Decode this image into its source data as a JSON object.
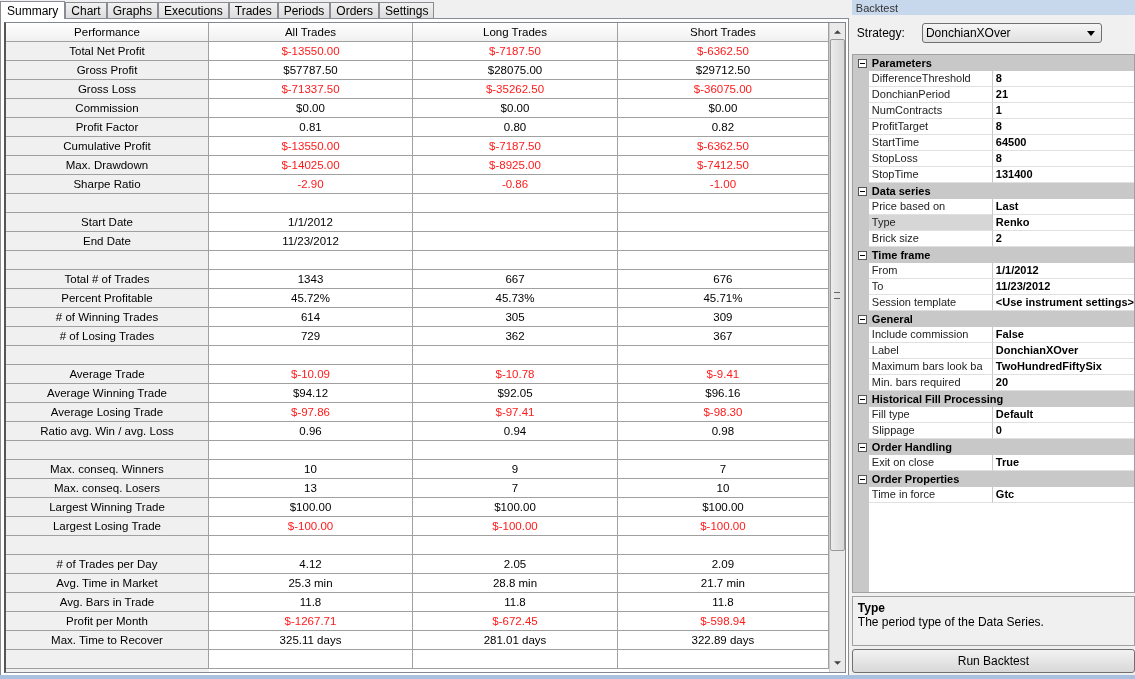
{
  "tabs": [
    {
      "label": "Summary",
      "selected": true
    },
    {
      "label": "Chart",
      "selected": false
    },
    {
      "label": "Graphs",
      "selected": false
    },
    {
      "label": "Executions",
      "selected": false
    },
    {
      "label": "Trades",
      "selected": false
    },
    {
      "label": "Periods",
      "selected": false
    },
    {
      "label": "Orders",
      "selected": false
    },
    {
      "label": "Settings",
      "selected": false
    }
  ],
  "table": {
    "columns": [
      "Performance",
      "All Trades",
      "Long Trades",
      "Short Trades"
    ],
    "rows": [
      {
        "kind": "stat",
        "label": "Total Net Profit",
        "values": [
          {
            "text": "$-13550.00",
            "negative": true
          },
          {
            "text": "$-7187.50",
            "negative": true
          },
          {
            "text": "$-6362.50",
            "negative": true
          }
        ]
      },
      {
        "kind": "stat",
        "label": "Gross Profit",
        "values": [
          {
            "text": "$57787.50",
            "negative": false
          },
          {
            "text": "$28075.00",
            "negative": false
          },
          {
            "text": "$29712.50",
            "negative": false
          }
        ]
      },
      {
        "kind": "stat",
        "label": "Gross Loss",
        "values": [
          {
            "text": "$-71337.50",
            "negative": true
          },
          {
            "text": "$-35262.50",
            "negative": true
          },
          {
            "text": "$-36075.00",
            "negative": true
          }
        ]
      },
      {
        "kind": "stat",
        "label": "Commission",
        "values": [
          {
            "text": "$0.00",
            "negative": false
          },
          {
            "text": "$0.00",
            "negative": false
          },
          {
            "text": "$0.00",
            "negative": false
          }
        ]
      },
      {
        "kind": "stat",
        "label": "Profit Factor",
        "values": [
          {
            "text": "0.81",
            "negative": false
          },
          {
            "text": "0.80",
            "negative": false
          },
          {
            "text": "0.82",
            "negative": false
          }
        ]
      },
      {
        "kind": "stat",
        "label": "Cumulative Profit",
        "values": [
          {
            "text": "$-13550.00",
            "negative": true
          },
          {
            "text": "$-7187.50",
            "negative": true
          },
          {
            "text": "$-6362.50",
            "negative": true
          }
        ]
      },
      {
        "kind": "stat",
        "label": "Max. Drawdown",
        "values": [
          {
            "text": "$-14025.00",
            "negative": true
          },
          {
            "text": "$-8925.00",
            "negative": true
          },
          {
            "text": "$-7412.50",
            "negative": true
          }
        ]
      },
      {
        "kind": "stat",
        "label": "Sharpe Ratio",
        "values": [
          {
            "text": "-2.90",
            "negative": true
          },
          {
            "text": "-0.86",
            "negative": true
          },
          {
            "text": "-1.00",
            "negative": true
          }
        ]
      },
      {
        "kind": "spacer"
      },
      {
        "kind": "stat",
        "label": "Start Date",
        "values": [
          {
            "text": "1/1/2012",
            "negative": false
          }
        ]
      },
      {
        "kind": "stat",
        "label": "End Date",
        "values": [
          {
            "text": "11/23/2012",
            "negative": false
          }
        ]
      },
      {
        "kind": "spacer"
      },
      {
        "kind": "stat",
        "label": "Total # of Trades",
        "values": [
          {
            "text": "1343",
            "negative": false
          },
          {
            "text": "667",
            "negative": false
          },
          {
            "text": "676",
            "negative": false
          }
        ]
      },
      {
        "kind": "stat",
        "label": "Percent Profitable",
        "values": [
          {
            "text": "45.72%",
            "negative": false
          },
          {
            "text": "45.73%",
            "negative": false
          },
          {
            "text": "45.71%",
            "negative": false
          }
        ]
      },
      {
        "kind": "stat",
        "label": "# of Winning Trades",
        "values": [
          {
            "text": "614",
            "negative": false
          },
          {
            "text": "305",
            "negative": false
          },
          {
            "text": "309",
            "negative": false
          }
        ]
      },
      {
        "kind": "stat",
        "label": "# of Losing Trades",
        "values": [
          {
            "text": "729",
            "negative": false
          },
          {
            "text": "362",
            "negative": false
          },
          {
            "text": "367",
            "negative": false
          }
        ]
      },
      {
        "kind": "spacer"
      },
      {
        "kind": "stat",
        "label": "Average Trade",
        "values": [
          {
            "text": "$-10.09",
            "negative": true
          },
          {
            "text": "$-10.78",
            "negative": true
          },
          {
            "text": "$-9.41",
            "negative": true
          }
        ]
      },
      {
        "kind": "stat",
        "label": "Average Winning Trade",
        "values": [
          {
            "text": "$94.12",
            "negative": false
          },
          {
            "text": "$92.05",
            "negative": false
          },
          {
            "text": "$96.16",
            "negative": false
          }
        ]
      },
      {
        "kind": "stat",
        "label": "Average Losing Trade",
        "values": [
          {
            "text": "$-97.86",
            "negative": true
          },
          {
            "text": "$-97.41",
            "negative": true
          },
          {
            "text": "$-98.30",
            "negative": true
          }
        ]
      },
      {
        "kind": "stat",
        "label": "Ratio avg. Win / avg. Loss",
        "values": [
          {
            "text": "0.96",
            "negative": false
          },
          {
            "text": "0.94",
            "negative": false
          },
          {
            "text": "0.98",
            "negative": false
          }
        ]
      },
      {
        "kind": "spacer"
      },
      {
        "kind": "stat",
        "label": "Max. conseq. Winners",
        "values": [
          {
            "text": "10",
            "negative": false
          },
          {
            "text": "9",
            "negative": false
          },
          {
            "text": "7",
            "negative": false
          }
        ]
      },
      {
        "kind": "stat",
        "label": "Max. conseq. Losers",
        "values": [
          {
            "text": "13",
            "negative": false
          },
          {
            "text": "7",
            "negative": false
          },
          {
            "text": "10",
            "negative": false
          }
        ]
      },
      {
        "kind": "stat",
        "label": "Largest Winning Trade",
        "values": [
          {
            "text": "$100.00",
            "negative": false
          },
          {
            "text": "$100.00",
            "negative": false
          },
          {
            "text": "$100.00",
            "negative": false
          }
        ]
      },
      {
        "kind": "stat",
        "label": "Largest Losing Trade",
        "values": [
          {
            "text": "$-100.00",
            "negative": true
          },
          {
            "text": "$-100.00",
            "negative": true
          },
          {
            "text": "$-100.00",
            "negative": true
          }
        ]
      },
      {
        "kind": "spacer"
      },
      {
        "kind": "stat",
        "label": "# of Trades per Day",
        "values": [
          {
            "text": "4.12",
            "negative": false
          },
          {
            "text": "2.05",
            "negative": false
          },
          {
            "text": "2.09",
            "negative": false
          }
        ]
      },
      {
        "kind": "stat",
        "label": "Avg. Time in Market",
        "values": [
          {
            "text": "25.3 min",
            "negative": false
          },
          {
            "text": "28.8 min",
            "negative": false
          },
          {
            "text": "21.7 min",
            "negative": false
          }
        ]
      },
      {
        "kind": "stat",
        "label": "Avg. Bars in Trade",
        "values": [
          {
            "text": "11.8",
            "negative": false
          },
          {
            "text": "11.8",
            "negative": false
          },
          {
            "text": "11.8",
            "negative": false
          }
        ]
      },
      {
        "kind": "stat",
        "label": "Profit per Month",
        "values": [
          {
            "text": "$-1267.71",
            "negative": true
          },
          {
            "text": "$-672.45",
            "negative": true
          },
          {
            "text": "$-598.94",
            "negative": true
          }
        ]
      },
      {
        "kind": "stat",
        "label": "Max. Time to Recover",
        "values": [
          {
            "text": "325.11 days",
            "negative": false
          },
          {
            "text": "281.01 days",
            "negative": false
          },
          {
            "text": "322.89 days",
            "negative": false
          }
        ]
      },
      {
        "kind": "spacer"
      }
    ]
  },
  "backtest": {
    "title": "Backtest",
    "strategy_label": "Strategy:",
    "strategy": "DonchianXOver",
    "categories": [
      {
        "name": "Parameters",
        "expanded": true,
        "properties": [
          {
            "name": "DifferenceThreshold",
            "value": "8",
            "selected": false
          },
          {
            "name": "DonchianPeriod",
            "value": "21",
            "selected": false
          },
          {
            "name": "NumContracts",
            "value": "1",
            "selected": false
          },
          {
            "name": "ProfitTarget",
            "value": "8",
            "selected": false
          },
          {
            "name": "StartTime",
            "value": "64500",
            "selected": false
          },
          {
            "name": "StopLoss",
            "value": "8",
            "selected": false
          },
          {
            "name": "StopTime",
            "value": "131400",
            "selected": false
          }
        ]
      },
      {
        "name": "Data series",
        "expanded": true,
        "properties": [
          {
            "name": "Price based on",
            "value": "Last",
            "selected": false
          },
          {
            "name": "Type",
            "value": "Renko",
            "selected": true
          },
          {
            "name": "Brick size",
            "value": "2",
            "selected": false
          }
        ]
      },
      {
        "name": "Time frame",
        "expanded": true,
        "properties": [
          {
            "name": "From",
            "value": "1/1/2012",
            "selected": false
          },
          {
            "name": "To",
            "value": "11/23/2012",
            "selected": false
          },
          {
            "name": "Session template",
            "value": "<Use instrument settings>",
            "selected": false
          }
        ]
      },
      {
        "name": "General",
        "expanded": true,
        "properties": [
          {
            "name": "Include commission",
            "value": "False",
            "selected": false
          },
          {
            "name": "Label",
            "value": "DonchianXOver",
            "selected": false
          },
          {
            "name": "Maximum bars look ba",
            "value": "TwoHundredFiftySix",
            "selected": false
          },
          {
            "name": "Min. bars required",
            "value": "20",
            "selected": false
          }
        ]
      },
      {
        "name": "Historical Fill Processing",
        "expanded": true,
        "properties": [
          {
            "name": "Fill type",
            "value": "Default",
            "selected": false
          },
          {
            "name": "Slippage",
            "value": "0",
            "selected": false
          }
        ]
      },
      {
        "name": "Order Handling",
        "expanded": true,
        "properties": [
          {
            "name": "Exit on close",
            "value": "True",
            "selected": false
          }
        ]
      },
      {
        "name": "Order Properties",
        "expanded": true,
        "properties": [
          {
            "name": "Time in force",
            "value": "Gtc",
            "selected": false
          }
        ]
      }
    ],
    "description": {
      "title": "Type",
      "text": "The period type of the Data Series."
    },
    "run_button": "Run Backtest"
  }
}
